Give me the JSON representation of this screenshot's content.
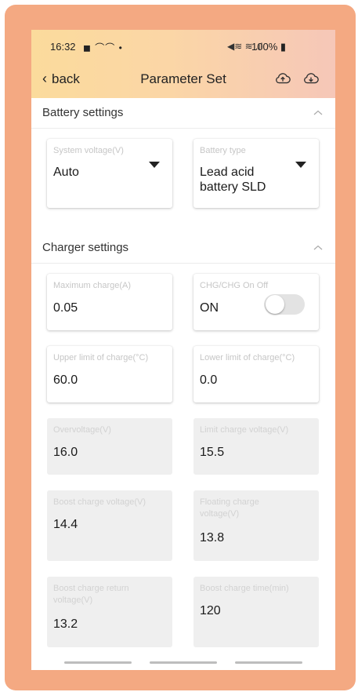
{
  "status_bar": {
    "time": "16:32",
    "notifications": "◼ ⌒⌒ •",
    "signal": "◀≋ ≋ .ıl",
    "battery": "100%"
  },
  "nav": {
    "back_label": "back",
    "title": "Parameter Set"
  },
  "battery_settings": {
    "title": "Battery settings",
    "system_voltage": {
      "label": "System voltage(V)",
      "value": "Auto"
    },
    "battery_type": {
      "label": "Battery type",
      "value": "Lead acid battery SLD"
    }
  },
  "charger_settings": {
    "title": "Charger settings",
    "maximum_charge": {
      "label": "Maximum charge(A)",
      "value": "0.05"
    },
    "chg_on_off": {
      "label": "CHG/CHG On Off",
      "value": "ON",
      "toggle_on": false
    },
    "upper_limit": {
      "label": "Upper limit of charge(°C)",
      "value": "60.0"
    },
    "lower_limit": {
      "label": "Lower limit of charge(°C)",
      "value": "0.0"
    },
    "overvoltage": {
      "label": "Overvoltage(V)",
      "value": "16.0"
    },
    "limit_charge_voltage": {
      "label": "Limit charge voltage(V)",
      "value": "15.5"
    },
    "boost_charge_voltage": {
      "label": "Boost charge voltage(V)",
      "value": "14.4"
    },
    "floating_charge_voltage": {
      "label": "Floating charge voltage(V)",
      "value": "13.8"
    },
    "boost_charge_return_voltage": {
      "label": "Boost charge return voltage(V)",
      "value": "13.2"
    },
    "boost_charge_time": {
      "label": "Boost charge time(min)",
      "value": "120"
    }
  },
  "colors": {
    "frame": "#f4a982",
    "header_gradient_start": "#fbdb9c",
    "header_gradient_end": "#f6c7b8",
    "disabled_card": "#efefef"
  }
}
